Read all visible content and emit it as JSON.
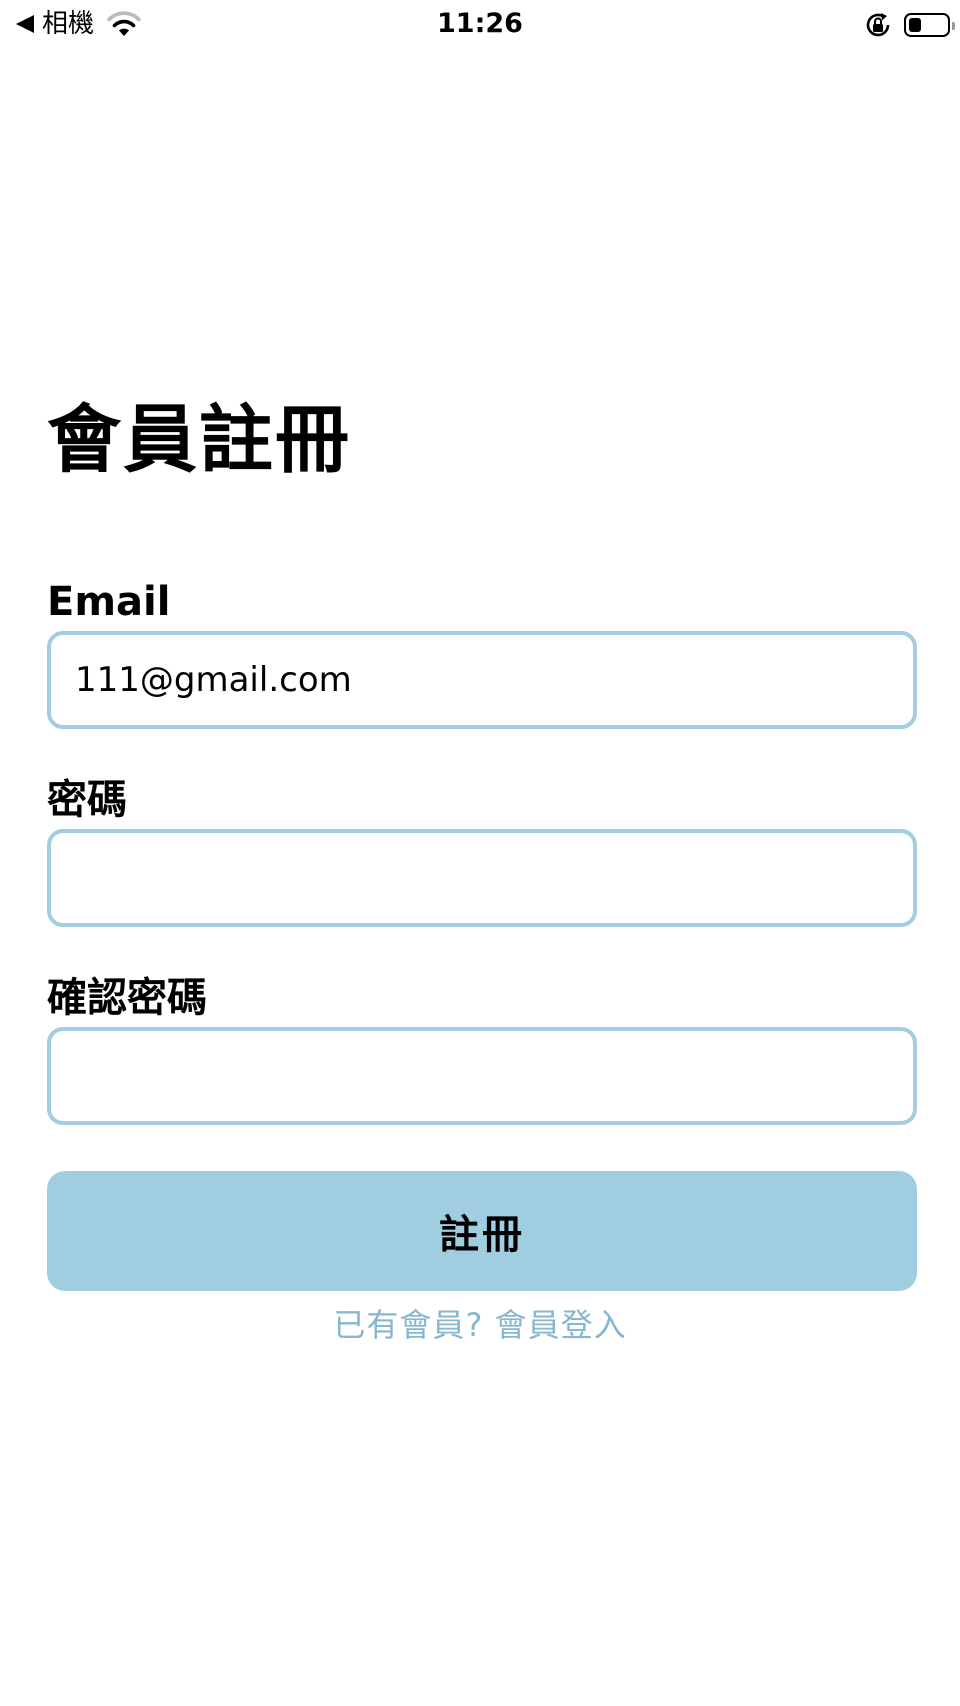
{
  "status_bar": {
    "back_label": "相機",
    "time": "11:26"
  },
  "page": {
    "title": "會員註冊"
  },
  "form": {
    "email_label": "Email",
    "email_value": "111@gmail.com",
    "password_label": "密碼",
    "password_value": "",
    "confirm_label": "確認密碼",
    "confirm_value": "",
    "submit_label": "註冊",
    "login_link": "已有會員? 會員登入"
  },
  "colors": {
    "accent": "#a0cde0",
    "input_border": "#a3cde0",
    "link": "#86b7cf"
  },
  "icons": {
    "back": "back-arrow-icon",
    "wifi": "wifi-icon",
    "rotation_lock": "rotation-lock-icon",
    "battery": "battery-icon"
  }
}
